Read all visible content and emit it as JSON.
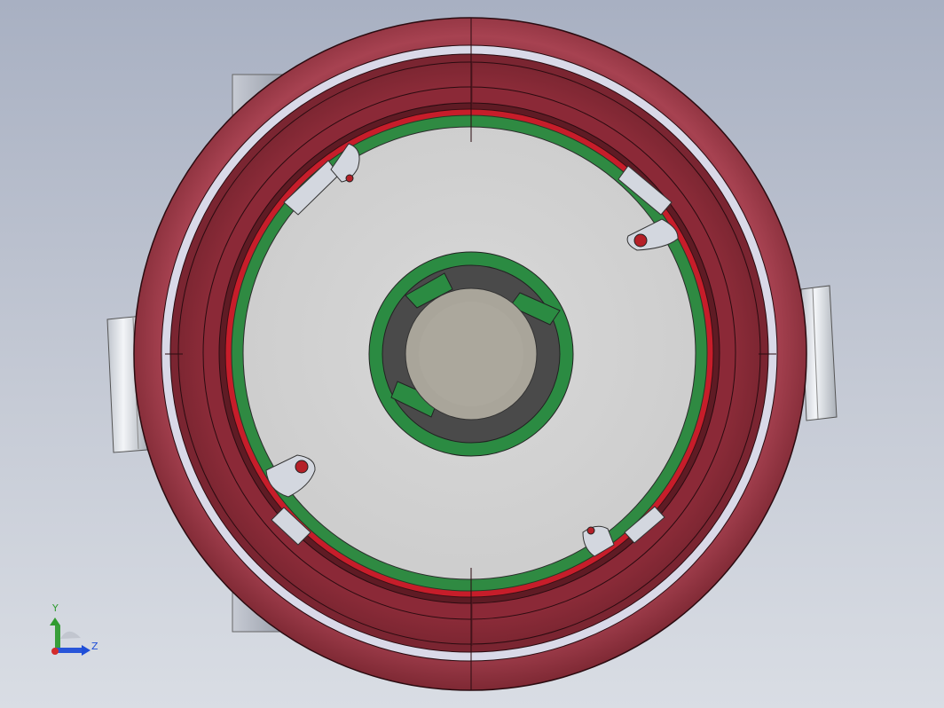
{
  "viewport": {
    "background_top": "#a8b0c2",
    "background_bottom": "#d9dde4"
  },
  "model": {
    "outer_ring_color": "#7f2b35",
    "outer_ring_highlight": "#b24c5a",
    "inner_ring_color": "#6e222c",
    "light_band_color": "#d8d8e8",
    "red_seal_color": "#c01824",
    "green_ring_color": "#2f8a42",
    "face_color": "#d4d4d4",
    "tab_color": "#d3d7df",
    "hub_green": "#2b8b42",
    "hub_dark": "#4b4b4b",
    "hub_center": "#a9a59a",
    "clamp_color": "#d3d8e0"
  },
  "triad": {
    "y_label": "Y",
    "z_label": "Z",
    "y_color": "#2f9b2f",
    "z_color": "#1f4ed8",
    "x_color": "#d42b2b"
  }
}
